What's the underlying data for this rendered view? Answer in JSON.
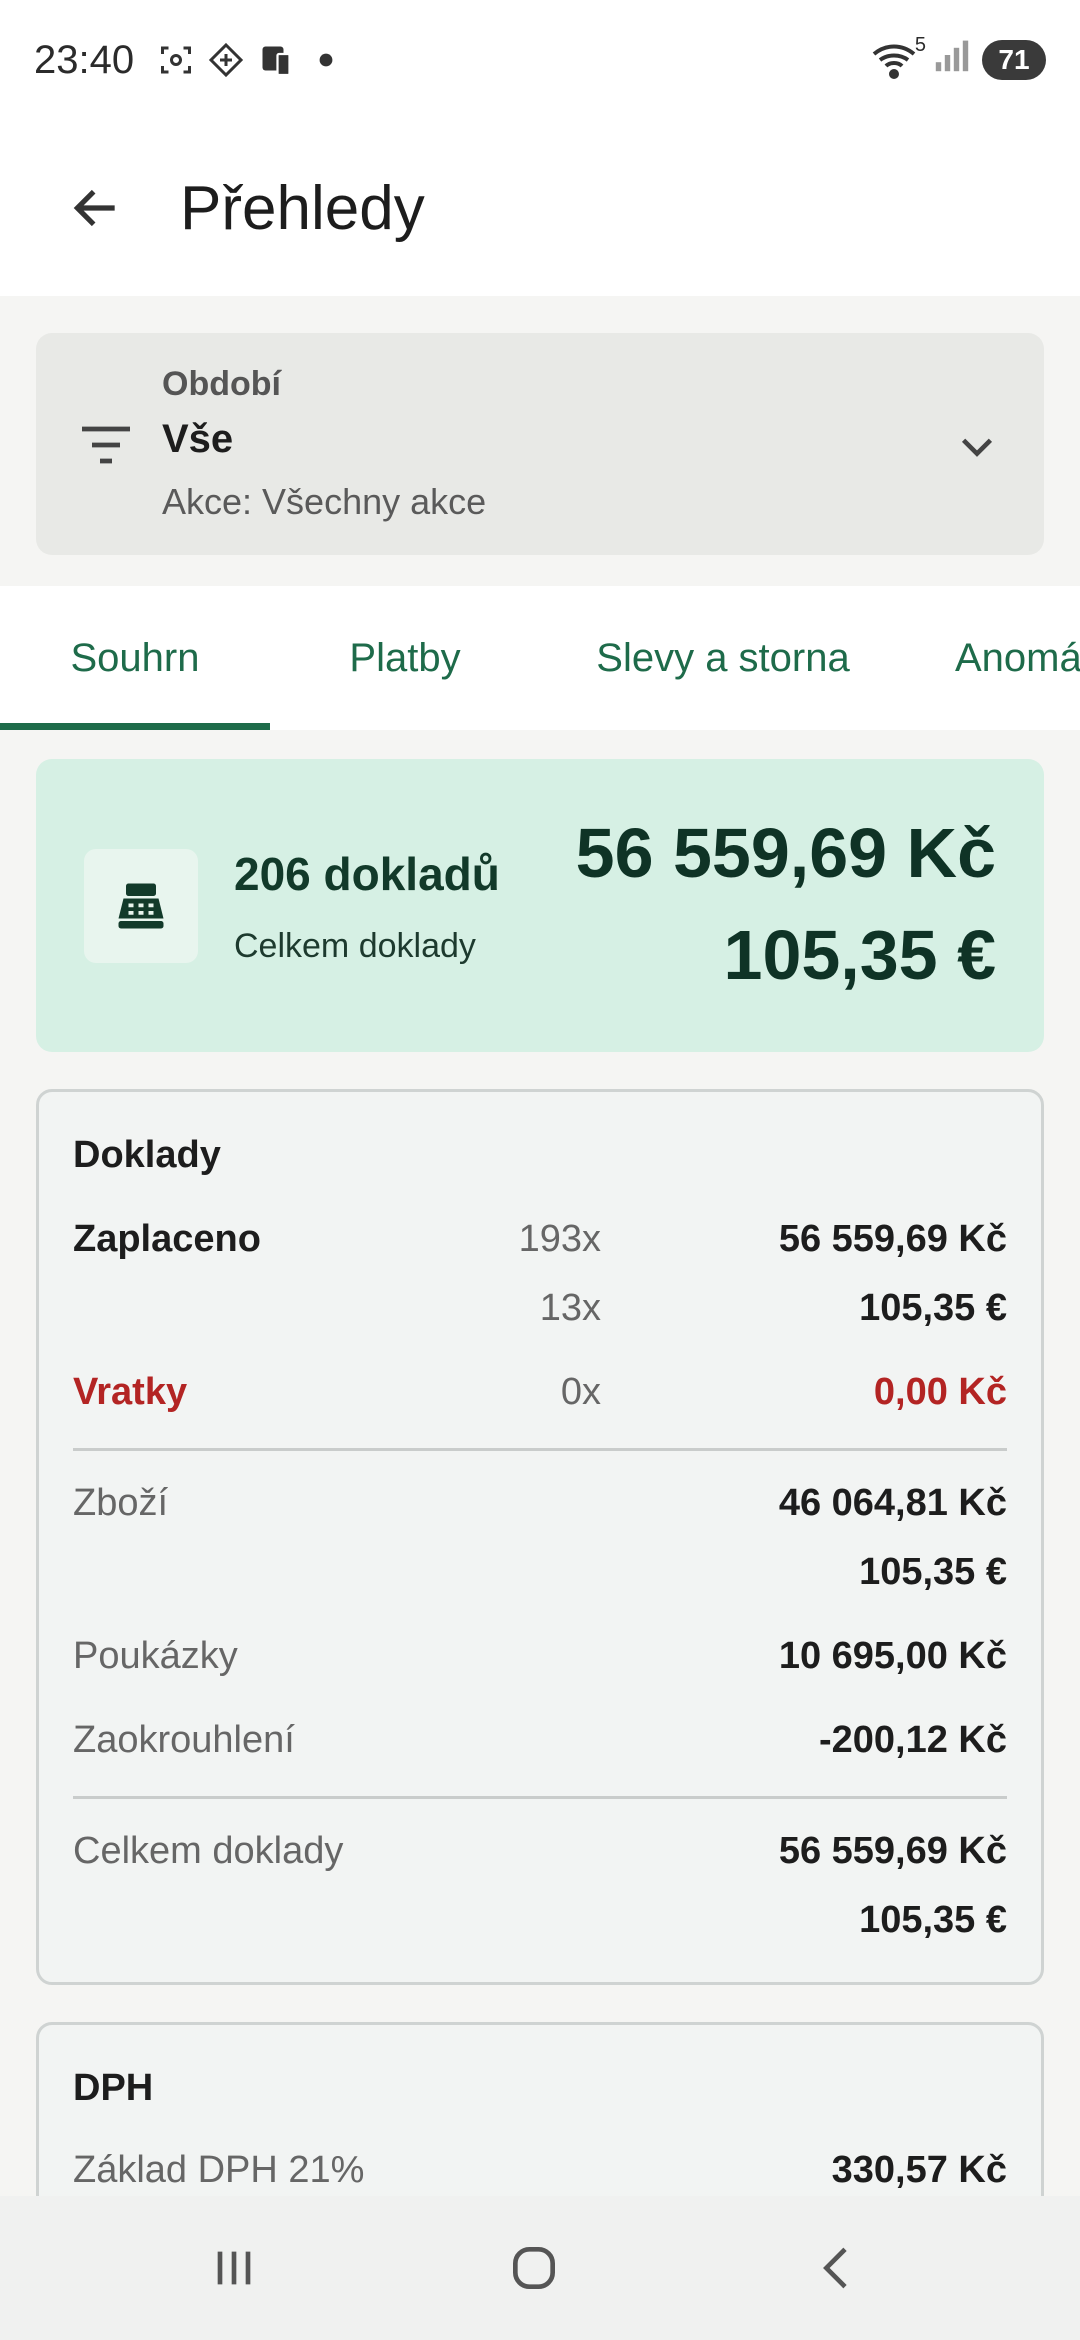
{
  "status": {
    "time": "23:40",
    "battery": "71",
    "wifi_badge": "5",
    "icons": [
      "screenshot-icon",
      "vpn-icon",
      "device-icon",
      "notification-dot-icon",
      "wifi-icon",
      "signal-icon"
    ]
  },
  "appbar": {
    "title": "Přehledy",
    "back_icon": "arrow-left-icon"
  },
  "filter": {
    "label": "Období",
    "value": "Vše",
    "subtitle": "Akce: Všechny akce",
    "icon": "filter-icon",
    "chevron": "chevron-down-icon"
  },
  "tabs": [
    {
      "label": "Souhrn",
      "active": true
    },
    {
      "label": "Platby",
      "active": false
    },
    {
      "label": "Slevy a storna",
      "active": false
    },
    {
      "label": "Anomálie",
      "active": false
    }
  ],
  "summary": {
    "icon": "cash-register-icon",
    "count": "206 dokladů",
    "count_label": "Celkem doklady",
    "amount_czk": "56 559,69 Kč",
    "amount_eur": "105,35 €"
  },
  "doklady": {
    "title": "Doklady",
    "paid_label": "Zaplaceno",
    "paid_rows": [
      {
        "count": "193x",
        "amount": "56 559,69 Kč"
      },
      {
        "count": "13x",
        "amount": "105,35 €"
      }
    ],
    "refund_label": "Vratky",
    "refund_count": "0x",
    "refund_amount": "0,00 Kč",
    "goods_label": "Zboží",
    "goods_czk": "46 064,81 Kč",
    "goods_eur": "105,35 €",
    "vouchers_label": "Poukázky",
    "vouchers_amount": "10 695,00 Kč",
    "rounding_label": "Zaokrouhlení",
    "rounding_amount": "-200,12 Kč",
    "total_label": "Celkem doklady",
    "total_czk": "56 559,69 Kč",
    "total_eur": "105,35 €"
  },
  "dph": {
    "title": "DPH",
    "base21_label": "Základ DPH 21%",
    "base21_amount": "330,57 Kč"
  },
  "colors": {
    "accent": "#1e6b4a",
    "summary_bg": "#d6f0e4",
    "negative": "#b32423"
  },
  "navbar": {
    "icons": [
      "recent-apps-icon",
      "home-icon",
      "back-icon"
    ]
  }
}
